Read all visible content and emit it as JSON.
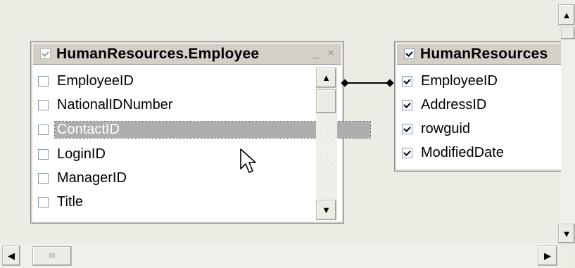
{
  "employee_table": {
    "title": "HumanResources.Employee",
    "minimize_glyph": "_",
    "close_glyph": "×",
    "title_checked": true,
    "columns": [
      {
        "label": "EmployeeID",
        "checked": false
      },
      {
        "label": "NationalIDNumber",
        "checked": false
      },
      {
        "label": "ContactID",
        "checked": false,
        "selected": true
      },
      {
        "label": "LoginID",
        "checked": false
      },
      {
        "label": "ManagerID",
        "checked": false
      },
      {
        "label": "Title",
        "checked": false
      }
    ],
    "scroll_up_glyph": "▲",
    "scroll_down_glyph": "▼"
  },
  "address_table": {
    "title": "HumanResources",
    "title_checked": true,
    "columns": [
      {
        "label": "EmployeeID",
        "checked": true
      },
      {
        "label": "AddressID",
        "checked": true
      },
      {
        "label": "rowguid",
        "checked": true
      },
      {
        "label": "ModifiedDate",
        "checked": true
      }
    ]
  },
  "scrollbars": {
    "up_glyph": "▲",
    "down_glyph": "▼",
    "left_glyph": "◀",
    "right_glyph": "▶",
    "grip_glyph": "III"
  }
}
